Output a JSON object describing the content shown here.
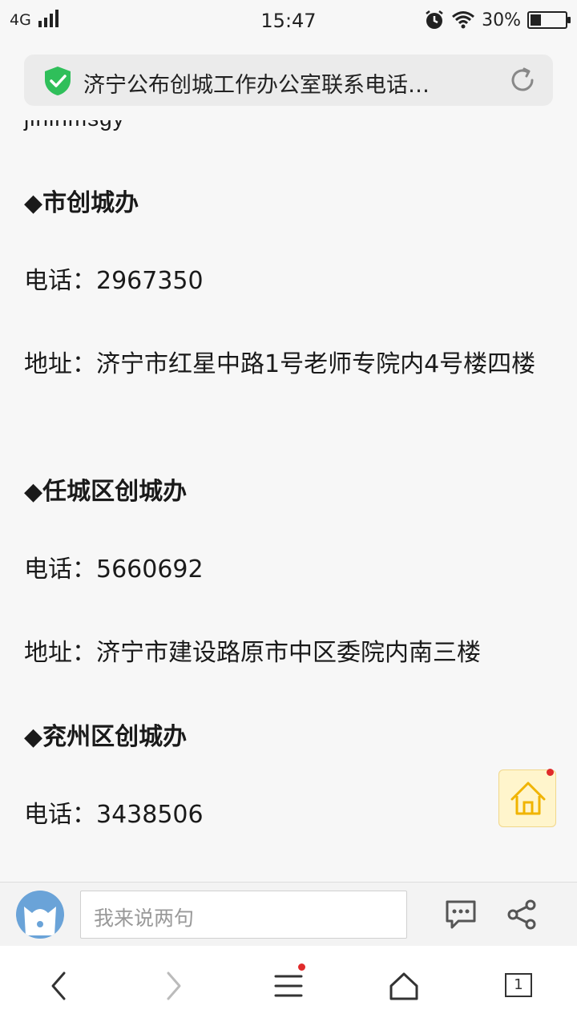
{
  "status_bar": {
    "network": "4G",
    "time": "15:47",
    "battery_percent_label": "30%",
    "battery_level": 0.3
  },
  "url_bar": {
    "title": "济宁公布创城工作办公室联系电话…"
  },
  "content": {
    "clipped_line": "jininmsgy",
    "sections": [
      {
        "heading": "◆市创城办",
        "phone": "电话：2967350",
        "address": "地址：济宁市红星中路1号老师专院内4号楼四楼"
      },
      {
        "heading": "◆任城区创城办",
        "phone": "电话：5660692",
        "address": "地址：济宁市建设路原市中区委院内南三楼"
      },
      {
        "heading": "◆兖州区创城办",
        "phone": "电话：3438506"
      }
    ]
  },
  "comment_bar": {
    "placeholder": "我来说两句"
  },
  "bottom_nav": {
    "tab_count": "1"
  },
  "colors": {
    "shield_green": "#2fbf5a",
    "home_icon_yellow": "#f0b400",
    "notification_red": "#e02b2b"
  }
}
